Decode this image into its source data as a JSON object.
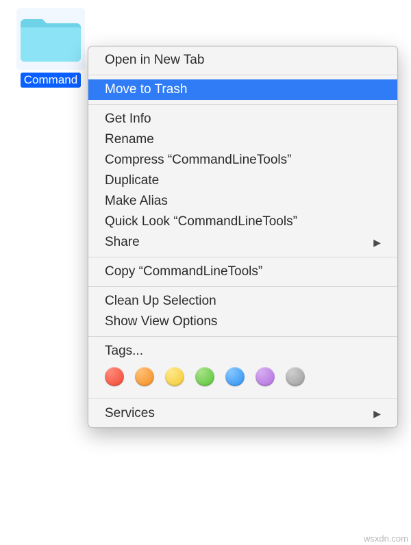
{
  "folder": {
    "label": "CommandLineTools",
    "label_visible": "Command"
  },
  "menu": {
    "open_new_tab": "Open in New Tab",
    "move_to_trash": "Move to Trash",
    "get_info": "Get Info",
    "rename": "Rename",
    "compress": "Compress “CommandLineTools”",
    "duplicate": "Duplicate",
    "make_alias": "Make Alias",
    "quick_look": "Quick Look “CommandLineTools”",
    "share": "Share",
    "copy": "Copy “CommandLineTools”",
    "clean_up": "Clean Up Selection",
    "show_view_options": "Show View Options",
    "tags": "Tags...",
    "services": "Services"
  },
  "tag_colors": {
    "red": "#f04530",
    "orange": "#f28a1c",
    "yellow": "#f2c631",
    "green": "#56c232",
    "blue": "#2a8ef0",
    "purple": "#b06be0",
    "gray": "#9a9a9a"
  },
  "watermark": "wsxdn.com"
}
